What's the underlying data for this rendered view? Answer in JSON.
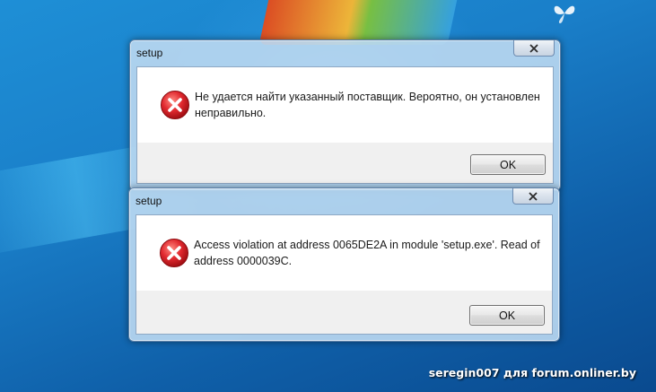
{
  "dialogs": [
    {
      "title": "setup",
      "message": "Не удается найти указанный поставщик. Вероятно, он установлен неправильно.",
      "ok_label": "OK",
      "icon": "error-icon",
      "close_icon": "close-icon"
    },
    {
      "title": "setup",
      "message": "Access violation at address 0065DE2A in module 'setup.exe'. Read of address 0000039C.",
      "ok_label": "OK",
      "icon": "error-icon",
      "close_icon": "close-icon"
    }
  ],
  "watermark": "seregin007 для forum.onliner.by",
  "colors": {
    "error_red": "#d9262c",
    "desktop_blue": "#1a7fc9"
  }
}
